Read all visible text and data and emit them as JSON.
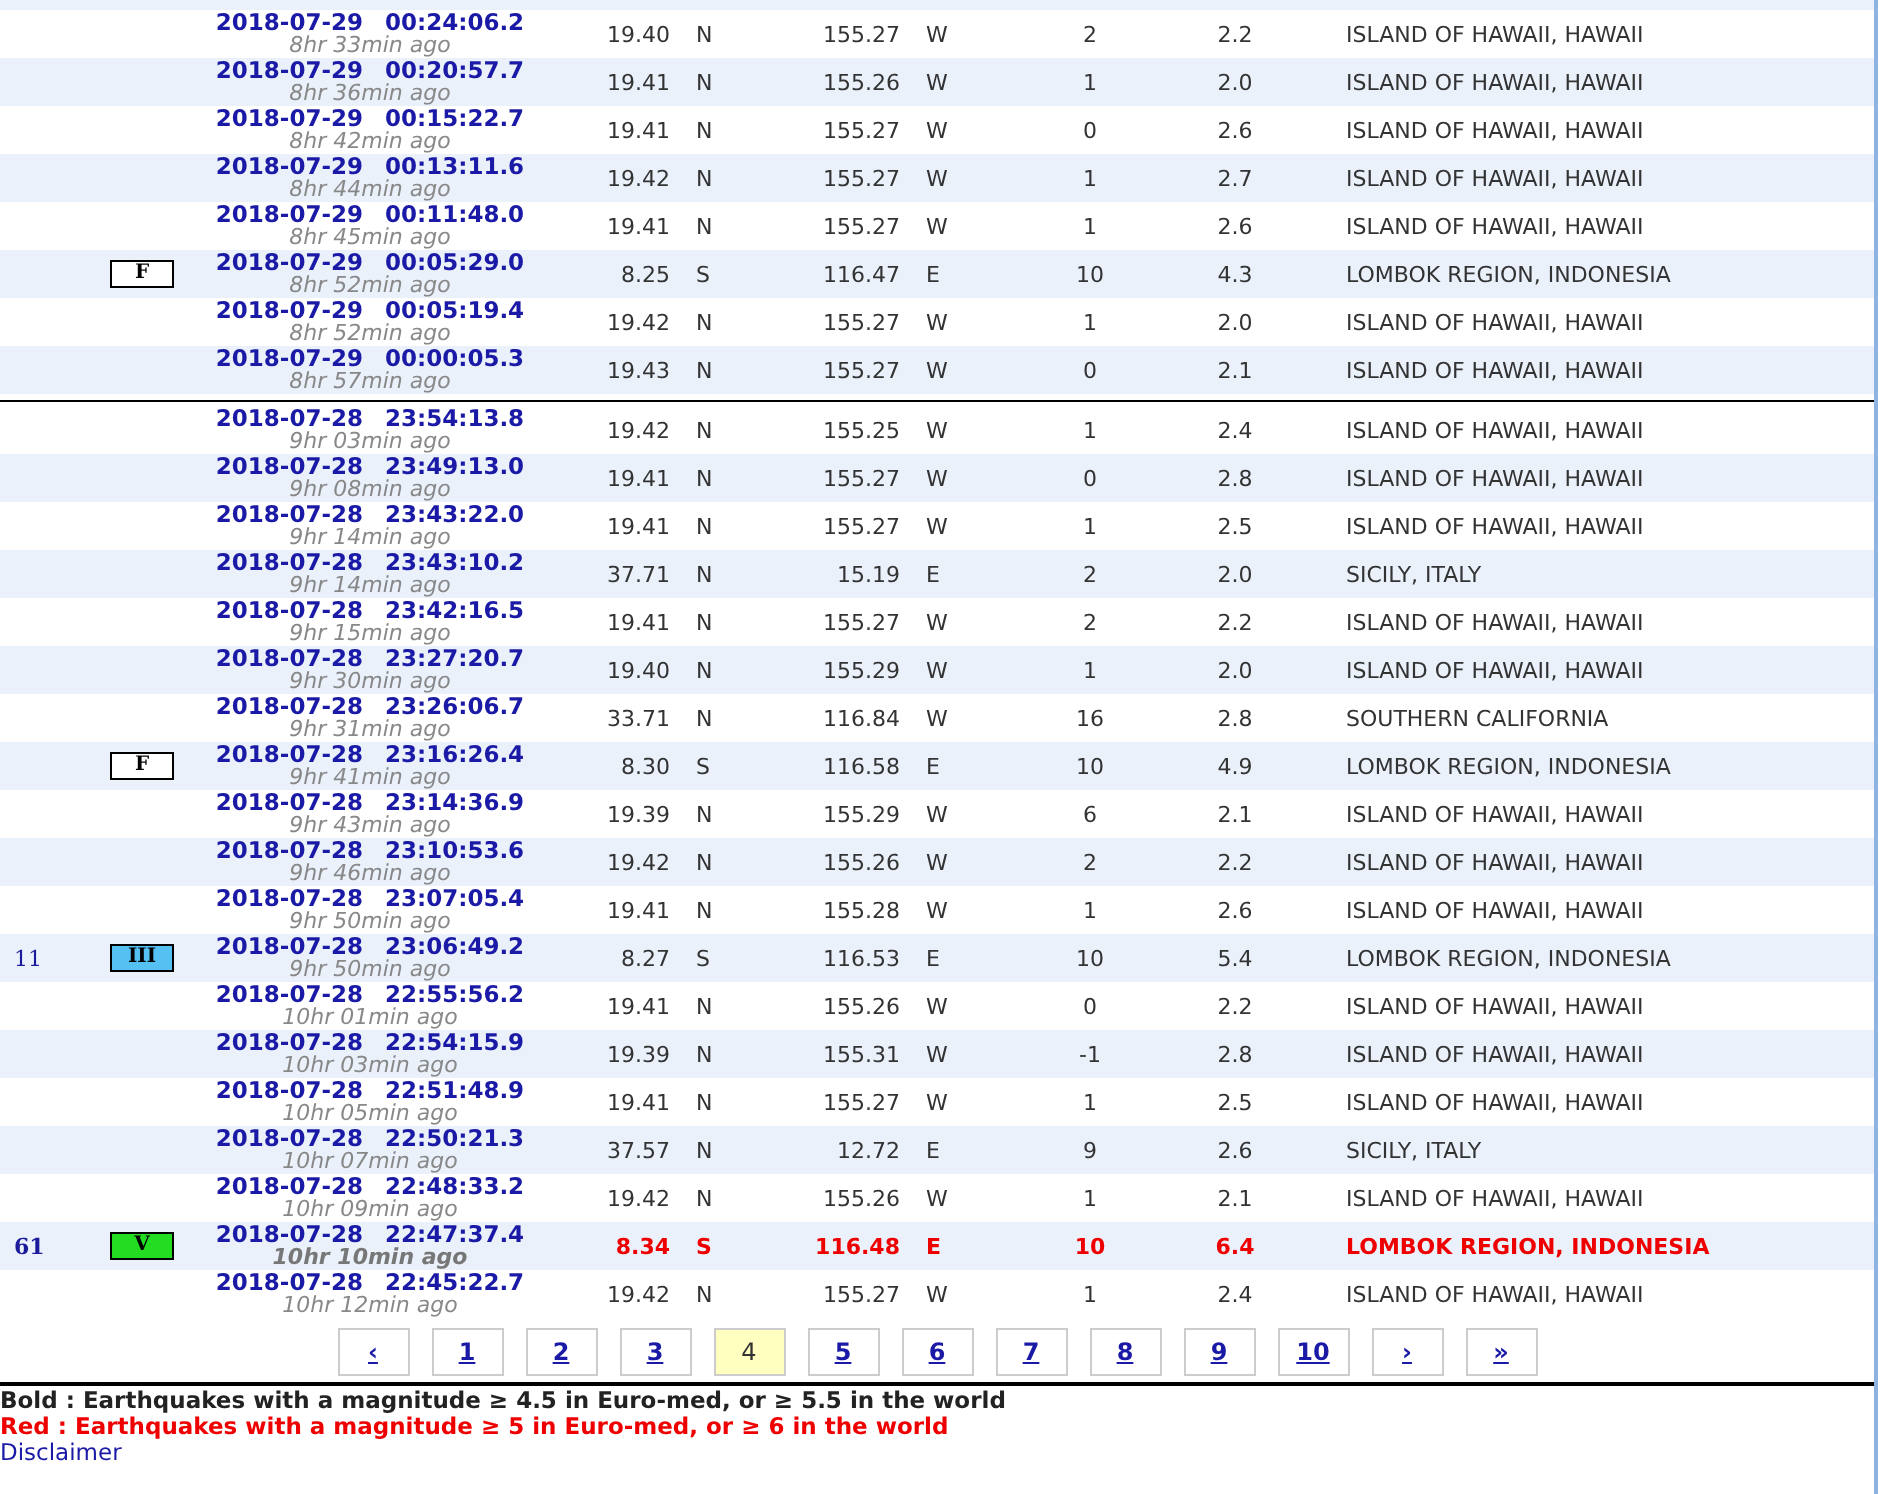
{
  "groups": [
    {
      "rows": [
        {
          "felt": "",
          "intensity": null,
          "datetime": "2018-07-29 00:24:06.2",
          "ago": "8hr 33min ago",
          "lat": "19.40",
          "ns": "N",
          "lon": "155.27",
          "ew": "W",
          "depth": "2",
          "mag": "2.2",
          "region": "ISLAND OF HAWAII, HAWAII",
          "red": false
        },
        {
          "felt": "",
          "intensity": null,
          "datetime": "2018-07-29 00:20:57.7",
          "ago": "8hr 36min ago",
          "lat": "19.41",
          "ns": "N",
          "lon": "155.26",
          "ew": "W",
          "depth": "1",
          "mag": "2.0",
          "region": "ISLAND OF HAWAII, HAWAII",
          "red": false
        },
        {
          "felt": "",
          "intensity": null,
          "datetime": "2018-07-29 00:15:22.7",
          "ago": "8hr 42min ago",
          "lat": "19.41",
          "ns": "N",
          "lon": "155.27",
          "ew": "W",
          "depth": "0",
          "mag": "2.6",
          "region": "ISLAND OF HAWAII, HAWAII",
          "red": false
        },
        {
          "felt": "",
          "intensity": null,
          "datetime": "2018-07-29 00:13:11.6",
          "ago": "8hr 44min ago",
          "lat": "19.42",
          "ns": "N",
          "lon": "155.27",
          "ew": "W",
          "depth": "1",
          "mag": "2.7",
          "region": "ISLAND OF HAWAII, HAWAII",
          "red": false
        },
        {
          "felt": "",
          "intensity": null,
          "datetime": "2018-07-29 00:11:48.0",
          "ago": "8hr 45min ago",
          "lat": "19.41",
          "ns": "N",
          "lon": "155.27",
          "ew": "W",
          "depth": "1",
          "mag": "2.6",
          "region": "ISLAND OF HAWAII, HAWAII",
          "red": false
        },
        {
          "felt": "",
          "intensity": {
            "label": "F",
            "color": "#ffffff"
          },
          "datetime": "2018-07-29 00:05:29.0",
          "ago": "8hr 52min ago",
          "lat": "8.25",
          "ns": "S",
          "lon": "116.47",
          "ew": "E",
          "depth": "10",
          "mag": "4.3",
          "region": "LOMBOK REGION, INDONESIA",
          "red": false
        },
        {
          "felt": "",
          "intensity": null,
          "datetime": "2018-07-29 00:05:19.4",
          "ago": "8hr 52min ago",
          "lat": "19.42",
          "ns": "N",
          "lon": "155.27",
          "ew": "W",
          "depth": "1",
          "mag": "2.0",
          "region": "ISLAND OF HAWAII, HAWAII",
          "red": false
        },
        {
          "felt": "",
          "intensity": null,
          "datetime": "2018-07-29 00:00:05.3",
          "ago": "8hr 57min ago",
          "lat": "19.43",
          "ns": "N",
          "lon": "155.27",
          "ew": "W",
          "depth": "0",
          "mag": "2.1",
          "region": "ISLAND OF HAWAII, HAWAII",
          "red": false
        }
      ]
    },
    {
      "rows": [
        {
          "felt": "",
          "intensity": null,
          "datetime": "2018-07-28 23:54:13.8",
          "ago": "9hr 03min ago",
          "lat": "19.42",
          "ns": "N",
          "lon": "155.25",
          "ew": "W",
          "depth": "1",
          "mag": "2.4",
          "region": "ISLAND OF HAWAII, HAWAII",
          "red": false
        },
        {
          "felt": "",
          "intensity": null,
          "datetime": "2018-07-28 23:49:13.0",
          "ago": "9hr 08min ago",
          "lat": "19.41",
          "ns": "N",
          "lon": "155.27",
          "ew": "W",
          "depth": "0",
          "mag": "2.8",
          "region": "ISLAND OF HAWAII, HAWAII",
          "red": false
        },
        {
          "felt": "",
          "intensity": null,
          "datetime": "2018-07-28 23:43:22.0",
          "ago": "9hr 14min ago",
          "lat": "19.41",
          "ns": "N",
          "lon": "155.27",
          "ew": "W",
          "depth": "1",
          "mag": "2.5",
          "region": "ISLAND OF HAWAII, HAWAII",
          "red": false
        },
        {
          "felt": "",
          "intensity": null,
          "datetime": "2018-07-28 23:43:10.2",
          "ago": "9hr 14min ago",
          "lat": "37.71",
          "ns": "N",
          "lon": "15.19",
          "ew": "E",
          "depth": "2",
          "mag": "2.0",
          "region": "SICILY, ITALY",
          "red": false
        },
        {
          "felt": "",
          "intensity": null,
          "datetime": "2018-07-28 23:42:16.5",
          "ago": "9hr 15min ago",
          "lat": "19.41",
          "ns": "N",
          "lon": "155.27",
          "ew": "W",
          "depth": "2",
          "mag": "2.2",
          "region": "ISLAND OF HAWAII, HAWAII",
          "red": false
        },
        {
          "felt": "",
          "intensity": null,
          "datetime": "2018-07-28 23:27:20.7",
          "ago": "9hr 30min ago",
          "lat": "19.40",
          "ns": "N",
          "lon": "155.29",
          "ew": "W",
          "depth": "1",
          "mag": "2.0",
          "region": "ISLAND OF HAWAII, HAWAII",
          "red": false
        },
        {
          "felt": "",
          "intensity": null,
          "datetime": "2018-07-28 23:26:06.7",
          "ago": "9hr 31min ago",
          "lat": "33.71",
          "ns": "N",
          "lon": "116.84",
          "ew": "W",
          "depth": "16",
          "mag": "2.8",
          "region": "SOUTHERN CALIFORNIA",
          "red": false
        },
        {
          "felt": "",
          "intensity": {
            "label": "F",
            "color": "#ffffff"
          },
          "datetime": "2018-07-28 23:16:26.4",
          "ago": "9hr 41min ago",
          "lat": "8.30",
          "ns": "S",
          "lon": "116.58",
          "ew": "E",
          "depth": "10",
          "mag": "4.9",
          "region": "LOMBOK REGION, INDONESIA",
          "red": false
        },
        {
          "felt": "",
          "intensity": null,
          "datetime": "2018-07-28 23:14:36.9",
          "ago": "9hr 43min ago",
          "lat": "19.39",
          "ns": "N",
          "lon": "155.29",
          "ew": "W",
          "depth": "6",
          "mag": "2.1",
          "region": "ISLAND OF HAWAII, HAWAII",
          "red": false
        },
        {
          "felt": "",
          "intensity": null,
          "datetime": "2018-07-28 23:10:53.6",
          "ago": "9hr 46min ago",
          "lat": "19.42",
          "ns": "N",
          "lon": "155.26",
          "ew": "W",
          "depth": "2",
          "mag": "2.2",
          "region": "ISLAND OF HAWAII, HAWAII",
          "red": false
        },
        {
          "felt": "",
          "intensity": null,
          "datetime": "2018-07-28 23:07:05.4",
          "ago": "9hr 50min ago",
          "lat": "19.41",
          "ns": "N",
          "lon": "155.28",
          "ew": "W",
          "depth": "1",
          "mag": "2.6",
          "region": "ISLAND OF HAWAII, HAWAII",
          "red": false
        },
        {
          "felt": "11",
          "intensity": {
            "label": "III",
            "color": "#55c1f2"
          },
          "datetime": "2018-07-28 23:06:49.2",
          "ago": "9hr 50min ago",
          "lat": "8.27",
          "ns": "S",
          "lon": "116.53",
          "ew": "E",
          "depth": "10",
          "mag": "5.4",
          "region": "LOMBOK REGION, INDONESIA",
          "red": false
        },
        {
          "felt": "",
          "intensity": null,
          "datetime": "2018-07-28 22:55:56.2",
          "ago": "10hr 01min ago",
          "lat": "19.41",
          "ns": "N",
          "lon": "155.26",
          "ew": "W",
          "depth": "0",
          "mag": "2.2",
          "region": "ISLAND OF HAWAII, HAWAII",
          "red": false
        },
        {
          "felt": "",
          "intensity": null,
          "datetime": "2018-07-28 22:54:15.9",
          "ago": "10hr 03min ago",
          "lat": "19.39",
          "ns": "N",
          "lon": "155.31",
          "ew": "W",
          "depth": "-1",
          "mag": "2.8",
          "region": "ISLAND OF HAWAII, HAWAII",
          "red": false
        },
        {
          "felt": "",
          "intensity": null,
          "datetime": "2018-07-28 22:51:48.9",
          "ago": "10hr 05min ago",
          "lat": "19.41",
          "ns": "N",
          "lon": "155.27",
          "ew": "W",
          "depth": "1",
          "mag": "2.5",
          "region": "ISLAND OF HAWAII, HAWAII",
          "red": false
        },
        {
          "felt": "",
          "intensity": null,
          "datetime": "2018-07-28 22:50:21.3",
          "ago": "10hr 07min ago",
          "lat": "37.57",
          "ns": "N",
          "lon": "12.72",
          "ew": "E",
          "depth": "9",
          "mag": "2.6",
          "region": "SICILY, ITALY",
          "red": false
        },
        {
          "felt": "",
          "intensity": null,
          "datetime": "2018-07-28 22:48:33.2",
          "ago": "10hr 09min ago",
          "lat": "19.42",
          "ns": "N",
          "lon": "155.26",
          "ew": "W",
          "depth": "1",
          "mag": "2.1",
          "region": "ISLAND OF HAWAII, HAWAII",
          "red": false
        },
        {
          "felt": "61",
          "intensity": {
            "label": "V",
            "color": "#22dd22"
          },
          "datetime": "2018-07-28 22:47:37.4",
          "ago": "10hr 10min ago",
          "lat": "8.34",
          "ns": "S",
          "lon": "116.48",
          "ew": "E",
          "depth": "10",
          "mag": "6.4",
          "region": "LOMBOK REGION, INDONESIA",
          "red": true
        },
        {
          "felt": "",
          "intensity": null,
          "datetime": "2018-07-28 22:45:22.7",
          "ago": "10hr 12min ago",
          "lat": "19.42",
          "ns": "N",
          "lon": "155.27",
          "ew": "W",
          "depth": "1",
          "mag": "2.4",
          "region": "ISLAND OF HAWAII, HAWAII",
          "red": false
        }
      ]
    }
  ],
  "pagination": [
    {
      "label": "‹",
      "selected": false
    },
    {
      "label": "1",
      "selected": false
    },
    {
      "label": "2",
      "selected": false
    },
    {
      "label": "3",
      "selected": false
    },
    {
      "label": "4",
      "selected": true
    },
    {
      "label": "5",
      "selected": false
    },
    {
      "label": "6",
      "selected": false
    },
    {
      "label": "7",
      "selected": false
    },
    {
      "label": "8",
      "selected": false
    },
    {
      "label": "9",
      "selected": false
    },
    {
      "label": "10",
      "selected": false
    },
    {
      "label": "›",
      "selected": false
    },
    {
      "label": "»",
      "selected": false
    }
  ],
  "legend": [
    {
      "kind": "bold",
      "text": "Bold : Earthquakes with a magnitude ≥ 4.5 in Euro-med, or ≥ 5.5 in the world"
    },
    {
      "kind": "red",
      "text": "Red : Earthquakes with a magnitude ≥ 5 in Euro-med, or ≥ 6 in the world"
    }
  ],
  "disclaimer": "Disclaimer"
}
